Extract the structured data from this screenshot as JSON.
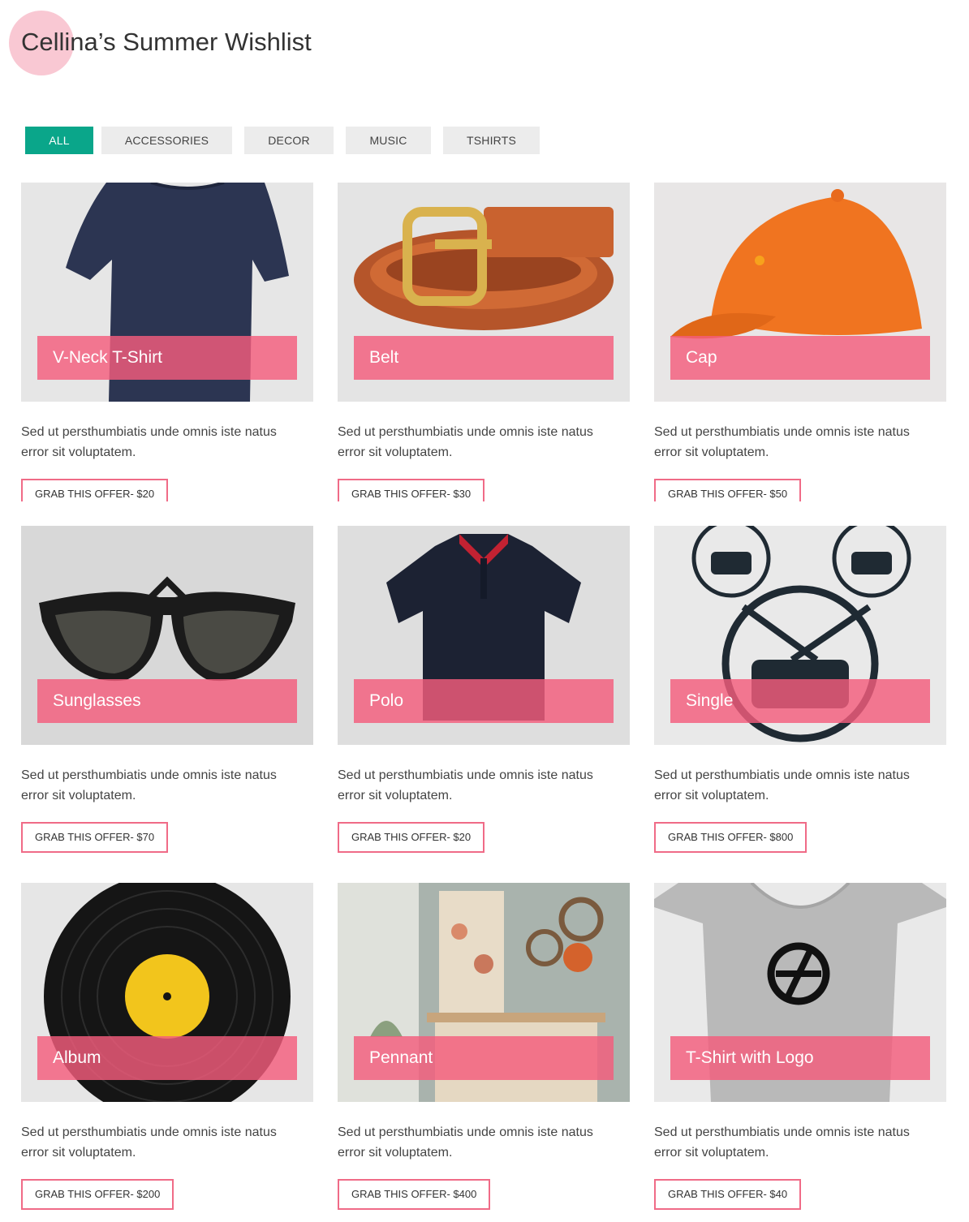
{
  "page": {
    "title": "Cellina’s Summer Wishlist"
  },
  "filters": [
    "ALL",
    "ACCESSORIES",
    "DECOR",
    "MUSIC",
    "TSHIRTS"
  ],
  "active_filter": "ALL",
  "colors": {
    "accent": "#0aa68a",
    "overlay": "#f45d7d",
    "offer_border": "#f06b87"
  },
  "products": [
    {
      "name": "V-Neck T-Shirt",
      "description": "Sed ut persthumbiatis unde omnis iste natus error sit voluptatem.",
      "offer": "GRAB THIS OFFER- $20",
      "image": "navy-tshirt-image"
    },
    {
      "name": "Belt",
      "description": "Sed ut persthumbiatis unde omnis iste natus error sit voluptatem.",
      "offer": "GRAB THIS OFFER- $30",
      "image": "leather-belt-image"
    },
    {
      "name": "Cap",
      "description": "Sed ut persthumbiatis unde omnis iste natus error sit voluptatem.",
      "offer": "GRAB THIS OFFER- $50",
      "image": "orange-cap-image"
    },
    {
      "name": "Sunglasses",
      "description": "Sed ut persthumbiatis unde omnis iste natus error sit voluptatem.",
      "offer": "GRAB THIS OFFER- $70",
      "image": "sunglasses-image"
    },
    {
      "name": "Polo",
      "description": "Sed ut persthumbiatis unde omnis iste natus error sit voluptatem.",
      "offer": "GRAB THIS OFFER- $20",
      "image": "polo-shirt-image"
    },
    {
      "name": "Single",
      "description": "Sed ut persthumbiatis unde omnis iste natus error sit voluptatem.",
      "offer": "GRAB THIS OFFER- $800",
      "image": "drum-icons-image"
    },
    {
      "name": "Album",
      "description": "Sed ut persthumbiatis unde omnis iste natus error sit voluptatem.",
      "offer": "GRAB THIS OFFER- $200",
      "image": "vinyl-record-image"
    },
    {
      "name": "Pennant",
      "description": "Sed ut persthumbiatis unde omnis iste natus error sit voluptatem.",
      "offer": "GRAB THIS OFFER- $400",
      "image": "interior-decor-image"
    },
    {
      "name": "T-Shirt with Logo",
      "description": "Sed ut persthumbiatis unde omnis iste natus error sit voluptatem.",
      "offer": "GRAB THIS OFFER- $40",
      "image": "grey-logo-tshirt-image"
    }
  ]
}
